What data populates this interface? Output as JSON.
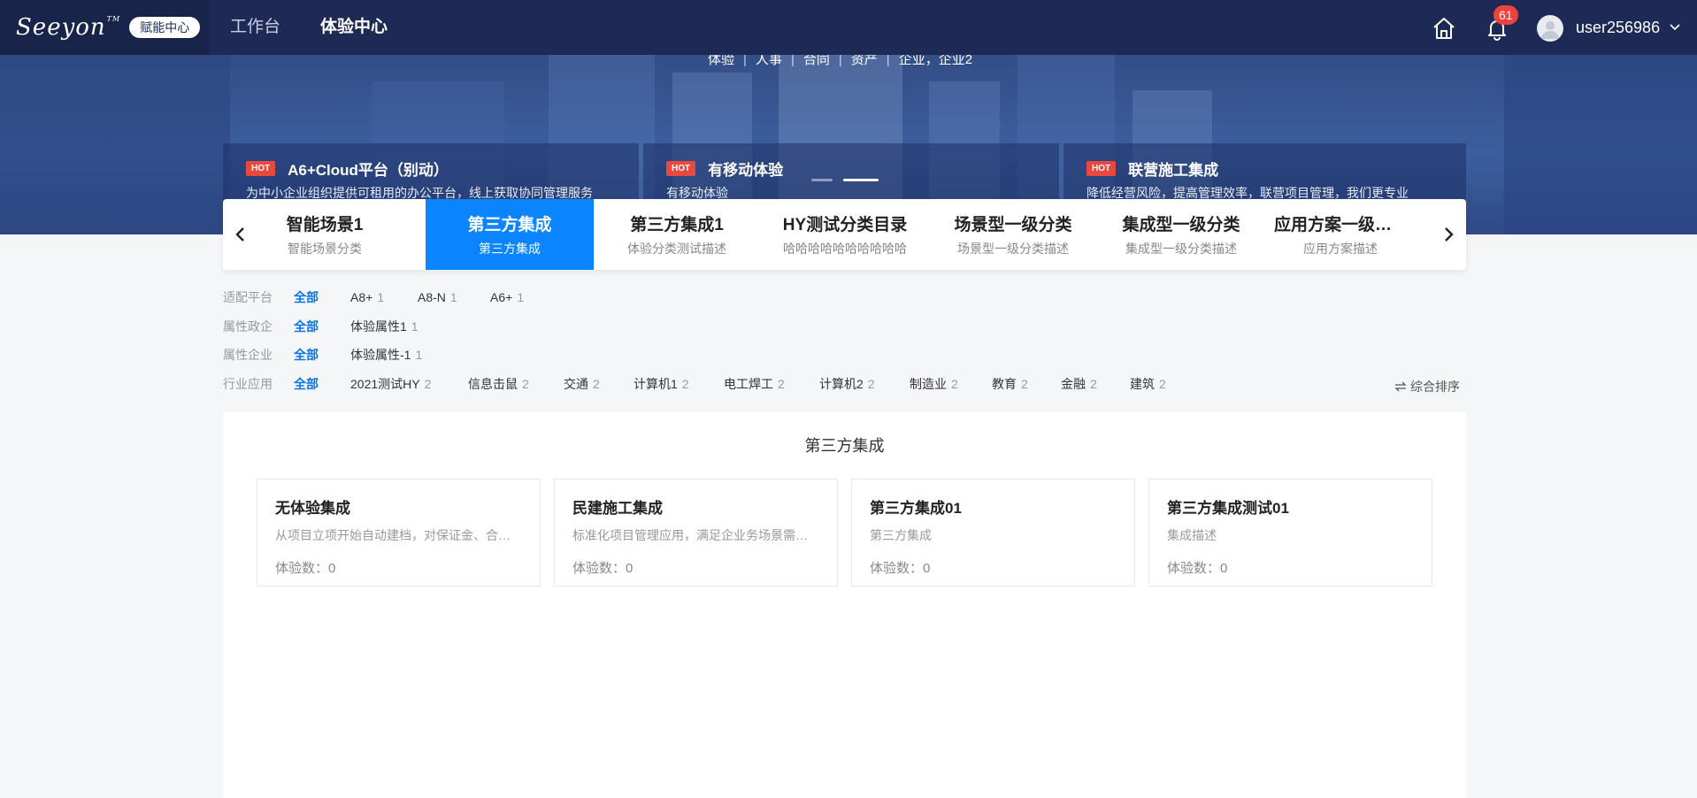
{
  "header": {
    "logo_text": "Seeyon",
    "logo_tm": "TM",
    "badge": "赋能中心",
    "nav": [
      {
        "label": "工作台",
        "active": false
      },
      {
        "label": "体验中心",
        "active": true
      }
    ],
    "notification_count": "61",
    "username": "user256986"
  },
  "banner": {
    "tags": [
      "体验",
      "人事",
      "合同",
      "资产",
      "企业，企业2"
    ],
    "hot_tag": "HOT",
    "cards": [
      {
        "title": "A6+Cloud平台（别动）",
        "desc": "为中小企业组织提供可租用的办公平台，线上获取协同管理服务"
      },
      {
        "title": "有移动体验",
        "desc": "有移动体验"
      },
      {
        "title": "联营施工集成",
        "desc": "降低经营风险，提高管理效率，联营项目管理，我们更专业"
      }
    ],
    "active_dot": 1
  },
  "categories": [
    {
      "title": "智能场景1",
      "sub": "智能场景分类",
      "active": false
    },
    {
      "title": "第三方集成",
      "sub": "第三方集成",
      "active": true
    },
    {
      "title": "第三方集成1",
      "sub": "体验分类测试描述",
      "active": false
    },
    {
      "title": "HY测试分类目录",
      "sub": "哈哈哈哈哈哈哈哈哈哈",
      "active": false
    },
    {
      "title": "场景型一级分类",
      "sub": "场景型一级分类描述",
      "active": false
    },
    {
      "title": "集成型一级分类",
      "sub": "集成型一级分类描述",
      "active": false
    },
    {
      "title": "应用方案一级分类",
      "sub": "应用方案描述",
      "active": false
    }
  ],
  "filters": [
    {
      "label": "适配平台",
      "all": "全部",
      "options": [
        {
          "name": "A8+",
          "count": "1"
        },
        {
          "name": "A8-N",
          "count": "1"
        },
        {
          "name": "A6+",
          "count": "1"
        }
      ]
    },
    {
      "label": "属性政企",
      "all": "全部",
      "options": [
        {
          "name": "体验属性1",
          "count": "1"
        }
      ]
    },
    {
      "label": "属性企业",
      "all": "全部",
      "options": [
        {
          "name": "体验属性-1",
          "count": "1"
        }
      ]
    },
    {
      "label": "行业应用",
      "all": "全部",
      "options": [
        {
          "name": "2021测试HY",
          "count": "2"
        },
        {
          "name": "信息击鼠",
          "count": "2"
        },
        {
          "name": "交通",
          "count": "2"
        },
        {
          "name": "计算机1",
          "count": "2"
        },
        {
          "name": "电工焊工",
          "count": "2"
        },
        {
          "name": "计算机2",
          "count": "2"
        },
        {
          "name": "制造业",
          "count": "2"
        },
        {
          "name": "教育",
          "count": "2"
        },
        {
          "name": "金融",
          "count": "2"
        },
        {
          "name": "建筑",
          "count": "2"
        }
      ]
    }
  ],
  "sort": {
    "label": "综合排序"
  },
  "panel": {
    "title": "第三方集成",
    "count_label": "体验数：",
    "cards": [
      {
        "title": "无体验集成",
        "desc": "从项目立项开始自动建档，对保证金、合同、成本进行管理",
        "count": "0"
      },
      {
        "title": "民建施工集成",
        "desc": "标准化项目管理应用，满足企业务场景需求的管理",
        "count": "0"
      },
      {
        "title": "第三方集成01",
        "desc": "第三方集成",
        "count": "0"
      },
      {
        "title": "第三方集成测试01",
        "desc": "集成描述",
        "count": "0"
      }
    ]
  },
  "colors": {
    "nav_bg": "#1d2a55",
    "accent": "#0a85ff",
    "hot": "#e9483f",
    "badge": "#f0423c"
  }
}
